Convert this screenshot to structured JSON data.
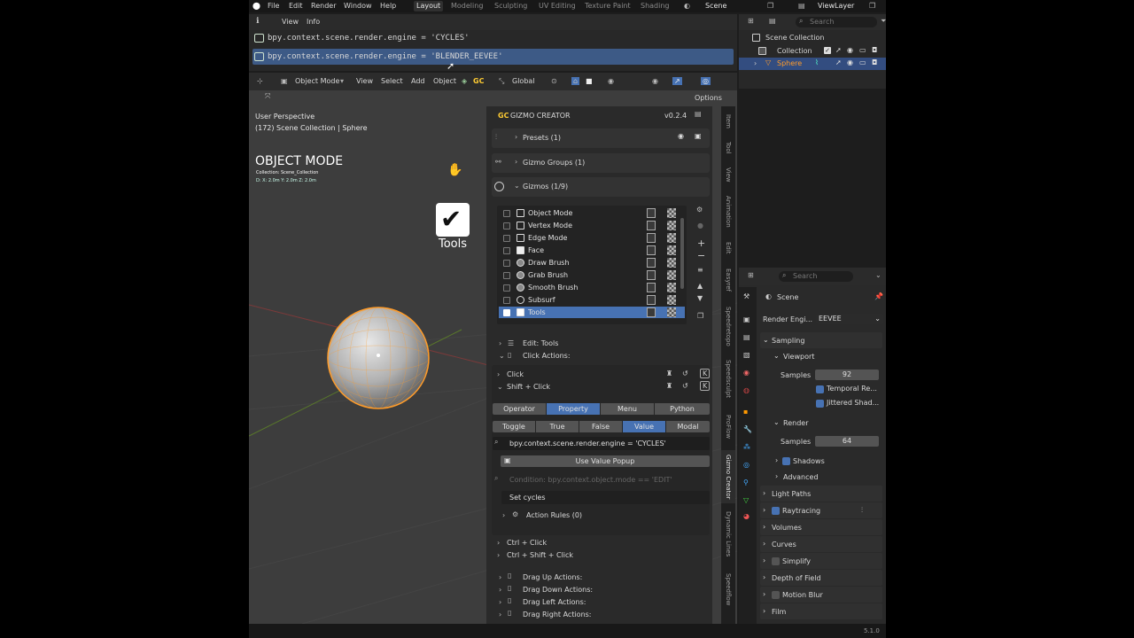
{
  "topbar": {
    "menus": [
      "File",
      "Edit",
      "Render",
      "Window",
      "Help"
    ],
    "workspaces": [
      "Layout",
      "Modeling",
      "Sculpting",
      "UV Editing",
      "Texture Paint",
      "Shading"
    ],
    "active_workspace": "Layout",
    "scene": "Scene",
    "view_layer": "ViewLayer"
  },
  "info": {
    "menu": [
      "View",
      "Info"
    ],
    "lines": [
      "bpy.context.scene.render.engine = 'CYCLES'",
      "bpy.context.scene.render.engine = 'BLENDER_EEVEE'"
    ]
  },
  "outliner": {
    "search_placeholder": "Search",
    "items": [
      "Scene Collection",
      "Collection",
      "Sphere"
    ]
  },
  "viewport": {
    "mode": "Object Mode",
    "menus": [
      "View",
      "Select",
      "Add",
      "Object"
    ],
    "orientation": "Global",
    "options": "Options",
    "perspective": "User Perspective",
    "context": "(172) Scene Collection | Sphere",
    "mode_title": "OBJECT MODE",
    "collection_line": "Collection: Scene_Collection",
    "dims_line": "D: X: 2.0m  Y: 2.0m  Z: 2.0m",
    "tools_label": "Tools"
  },
  "gizmo": {
    "title": "GIZMO CREATOR",
    "version": "v0.2.4",
    "presets": "Presets (1)",
    "groups": "Gizmo Groups (1)",
    "gizmos": "Gizmos (1/9)",
    "list": [
      "Object Mode",
      "Vertex Mode",
      "Edge Mode",
      "Face",
      "Draw Brush",
      "Grab Brush",
      "Smooth Brush",
      "Subsurf",
      "Tools"
    ],
    "selected_index": 8,
    "edit": "Edit: Tools",
    "click_actions": "Click Actions:",
    "click": "Click",
    "shift_click": "Shift + Click",
    "action_types": [
      "Operator",
      "Property",
      "Menu",
      "Python"
    ],
    "action_type_active": "Property",
    "prop_modes": [
      "Toggle",
      "True",
      "False",
      "Value",
      "Modal"
    ],
    "prop_mode_active": "Value",
    "property_path": "bpy.context.scene.render.engine = 'CYCLES'",
    "use_value_popup": "Use Value Popup",
    "condition_placeholder": "Condition: bpy.context.object.mode == 'EDIT'",
    "name_value": "Set cycles",
    "action_rules": "Action Rules (0)",
    "ctrl_click": "Ctrl + Click",
    "ctrl_shift_click": "Ctrl + Shift + Click",
    "drag": [
      "Drag Up Actions:",
      "Drag Down Actions:",
      "Drag Left Actions:",
      "Drag Right Actions:"
    ]
  },
  "tabs": [
    "Item",
    "Tool",
    "View",
    "Animation",
    "Edit",
    "Easyref",
    "Speedretopo",
    "Speedsculpt",
    "ProFlow",
    "Gizmo Creator",
    "Dynamic Lines",
    "Speedflow"
  ],
  "tab_active": "Gizmo Creator",
  "props": {
    "search_placeholder": "Search",
    "scene": "Scene",
    "render_engine_label": "Render Engi...",
    "render_engine": "EEVEE",
    "sampling": "Sampling",
    "viewport": "Viewport",
    "samples_label": "Samples",
    "viewport_samples": "92",
    "temporal": "Temporal Re...",
    "jittered": "Jittered Shad...",
    "render": "Render",
    "render_samples": "64",
    "shadows": "Shadows",
    "advanced": "Advanced",
    "light_paths": "Light Paths",
    "raytracing": "Raytracing",
    "volumes": "Volumes",
    "curves": "Curves",
    "simplify": "Simplify",
    "dof": "Depth of Field",
    "motion_blur": "Motion Blur",
    "film": "Film"
  },
  "status": {
    "version": "5.1.0"
  },
  "colors": {
    "accent": "#4772b3",
    "selection": "#3d5a86",
    "wire": "#ff9c2a"
  }
}
